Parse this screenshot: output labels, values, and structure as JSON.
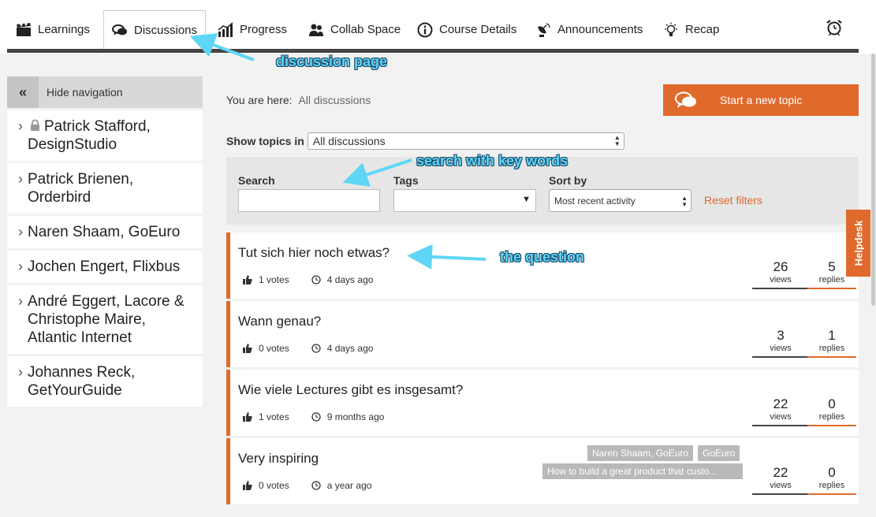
{
  "nav": {
    "tabs": [
      {
        "label": "Learnings",
        "icon": "clapperboard-icon"
      },
      {
        "label": "Discussions",
        "icon": "chat-bubbles-icon",
        "active": true
      },
      {
        "label": "Progress",
        "icon": "bar-chart-icon"
      },
      {
        "label": "Collab Space",
        "icon": "people-icon"
      },
      {
        "label": "Course Details",
        "icon": "info-icon"
      },
      {
        "label": "Announcements",
        "icon": "satellite-dish-icon"
      },
      {
        "label": "Recap",
        "icon": "lightbulb-icon"
      }
    ],
    "alarm_icon": "alarm-clock-icon"
  },
  "sidebar": {
    "hide_label": "Hide navigation",
    "items": [
      {
        "label": "Patrick Stafford, DesignStudio",
        "locked": true
      },
      {
        "label": "Patrick Brienen, Orderbird"
      },
      {
        "label": "Naren Shaam, GoEuro"
      },
      {
        "label": "Jochen Engert, Flixbus"
      },
      {
        "label": "André Eggert, Lacore & Christophe Maire, Atlantic Internet"
      },
      {
        "label": "Johannes Reck, GetYourGuide"
      }
    ]
  },
  "main": {
    "breadcrumb_prefix": "You are here:",
    "breadcrumb_current": "All discussions",
    "new_topic_label": "Start a new topic",
    "show_topics_label": "Show topics in",
    "show_topics_value": "All discussions",
    "search_label": "Search",
    "search_value": "",
    "tags_label": "Tags",
    "tags_value": "",
    "sort_label": "Sort by",
    "sort_value": "Most recent activity",
    "reset_label": "Reset filters"
  },
  "topics": [
    {
      "title": "Tut sich hier noch etwas?",
      "votes": "1 votes",
      "time": "4 days ago",
      "views": "26",
      "views_label": "views",
      "replies": "5",
      "replies_label": "replies",
      "tags": []
    },
    {
      "title": "Wann genau?",
      "votes": "0 votes",
      "time": "4 days ago",
      "views": "3",
      "views_label": "views",
      "replies": "1",
      "replies_label": "replies",
      "tags": []
    },
    {
      "title": "Wie viele Lectures gibt es insgesamt?",
      "votes": "1 votes",
      "time": "9 months ago",
      "views": "22",
      "views_label": "views",
      "replies": "0",
      "replies_label": "replies",
      "tags": []
    },
    {
      "title": "Very inspiring",
      "votes": "0 votes",
      "time": "a year ago",
      "views": "22",
      "views_label": "views",
      "replies": "0",
      "replies_label": "replies",
      "tags": [
        "Naren Shaam, GoEuro",
        "GoEuro",
        "How to build a great product that custo..."
      ]
    }
  ],
  "helpdesk_label": "Helpdesk",
  "annotations": {
    "discussion": "discussion page",
    "search": "search with key words",
    "question": "the question"
  },
  "colors": {
    "accent": "#e06a2c",
    "annotation": "#5fd6f5"
  }
}
